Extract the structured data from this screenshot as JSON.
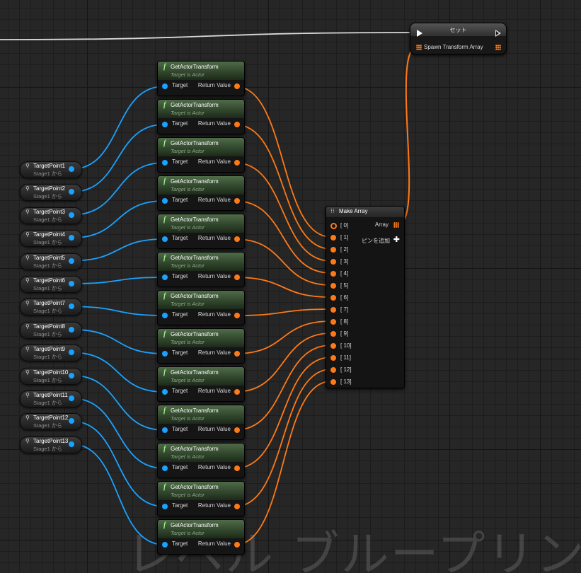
{
  "watermark": "レベル ブループリント",
  "set_node": {
    "title": "セット",
    "pin_label": "Spawn Transform Array"
  },
  "make_array": {
    "title": "Make Array",
    "inputs": [
      "[ 0]",
      "[ 1]",
      "[ 2]",
      "[ 3]",
      "[ 4]",
      "[ 5]",
      "[ 6]",
      "[ 7]",
      "[ 8]",
      "[ 9]",
      "[ 10]",
      "[ 11]",
      "[ 12]",
      "[ 13]"
    ],
    "output_label": "Array",
    "add_pin_label": "ピンを追加"
  },
  "function_nodes": {
    "title": "GetActorTransform",
    "subtitle": "Target is Actor",
    "input_label": "Target",
    "output_label": "Return Value",
    "count": 13
  },
  "target_points": [
    {
      "name": "TargetPoint1",
      "source": "Stage1 から"
    },
    {
      "name": "TargetPoint2",
      "source": "Stage1 から"
    },
    {
      "name": "TargetPoint3",
      "source": "Stage1 から"
    },
    {
      "name": "TargetPoint4",
      "source": "Stage1 から"
    },
    {
      "name": "TargetPoint5",
      "source": "Stage1 から"
    },
    {
      "name": "TargetPoint6",
      "source": "Stage1 から"
    },
    {
      "name": "TargetPoint7",
      "source": "Stage1 から"
    },
    {
      "name": "TargetPoint8",
      "source": "Stage1 から"
    },
    {
      "name": "TargetPoint9",
      "source": "Stage1 から"
    },
    {
      "name": "TargetPoint10",
      "source": "Stage1 から"
    },
    {
      "name": "TargetPoint11",
      "source": "Stage1 から"
    },
    {
      "name": "TargetPoint12",
      "source": "Stage1 から"
    },
    {
      "name": "TargetPoint13",
      "source": "Stage1 から"
    }
  ],
  "colors": {
    "object_pin": "#1aa2ff",
    "struct_pin": "#ff7a16",
    "exec_wire": "#d8d8d8",
    "function_header": "#3f5a39"
  },
  "icons": {
    "function": "function-f-icon",
    "make_array": "array-grid-icon",
    "variable": "actor-reference-icon",
    "add_pin": "plus-icon"
  }
}
